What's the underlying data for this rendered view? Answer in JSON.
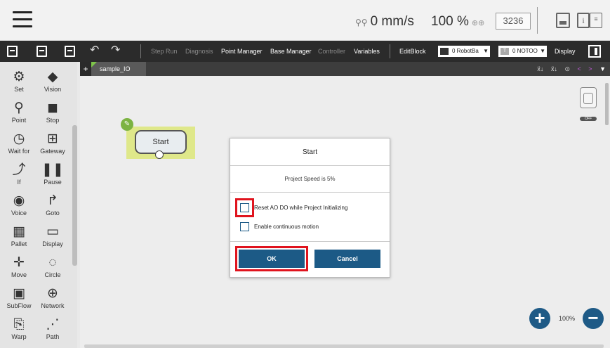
{
  "topbar": {
    "speed": "0 mm/s",
    "percent": "100 %",
    "counter": "3236",
    "info_glyph": "i",
    "log_glyph": "≡"
  },
  "toolbar": {
    "step_run": "Step Run",
    "diagnosis": "Diagnosis",
    "point_manager": "Point Manager",
    "base_manager": "Base Manager",
    "controller": "Controller",
    "variables": "Variables",
    "edit_block": "EditBlock",
    "robot_base": "0 RobotBa",
    "tool": "0 NOTOO",
    "tool_chip": "T",
    "display": "Display"
  },
  "sidebar": {
    "items": [
      {
        "label": "Set",
        "icon": "set-icon",
        "glyph": "⚙"
      },
      {
        "label": "Vision",
        "icon": "vision-icon",
        "glyph": "◆"
      },
      {
        "label": "Point",
        "icon": "point-icon",
        "glyph": "⚲"
      },
      {
        "label": "Stop",
        "icon": "stop-icon",
        "glyph": "◼"
      },
      {
        "label": "Wait for",
        "icon": "wait-for-icon",
        "glyph": "◷"
      },
      {
        "label": "Gateway",
        "icon": "gateway-icon",
        "glyph": "⊞"
      },
      {
        "label": "If",
        "icon": "if-icon",
        "glyph": "⤴"
      },
      {
        "label": "Pause",
        "icon": "pause-icon",
        "glyph": "❚❚"
      },
      {
        "label": "Voice",
        "icon": "voice-icon",
        "glyph": "◉"
      },
      {
        "label": "Goto",
        "icon": "goto-icon",
        "glyph": "↱"
      },
      {
        "label": "Pallet",
        "icon": "pallet-icon",
        "glyph": "▦"
      },
      {
        "label": "Display",
        "icon": "display-icon",
        "glyph": "▭"
      },
      {
        "label": "Move",
        "icon": "move-icon",
        "glyph": "✛"
      },
      {
        "label": "Circle",
        "icon": "circle-icon",
        "glyph": "◌"
      },
      {
        "label": "SubFlow",
        "icon": "subflow-icon",
        "glyph": "▣"
      },
      {
        "label": "Network",
        "icon": "network-icon",
        "glyph": "⊕"
      },
      {
        "label": "Warp",
        "icon": "warp-icon",
        "glyph": "⎘"
      },
      {
        "label": "Path",
        "icon": "path-icon",
        "glyph": "⋰"
      }
    ]
  },
  "tabs": {
    "add": "+",
    "active": "sample_IO",
    "tools": [
      "ẍ↓",
      "ẍ↓",
      "⊙"
    ],
    "prev": "<",
    "next": ">",
    "menu": "▼"
  },
  "canvas": {
    "start_node": "Start",
    "zoom_level": "100%",
    "edit_glyph": "✎",
    "off_label": "OFF"
  },
  "dialog": {
    "title": "Start",
    "message": "Project Speed is 5%",
    "option_reset": "Reset AO DO while Project Initializing",
    "option_reset_checked": false,
    "option_continuous": "Enable continuous motion",
    "option_continuous_checked": false,
    "ok": "OK",
    "cancel": "Cancel"
  },
  "colors": {
    "primary_button": "#1c5a86",
    "highlight": "#e0141e",
    "node_bg": "#dfe88a",
    "toolbar_bg": "#2b2b2b"
  }
}
